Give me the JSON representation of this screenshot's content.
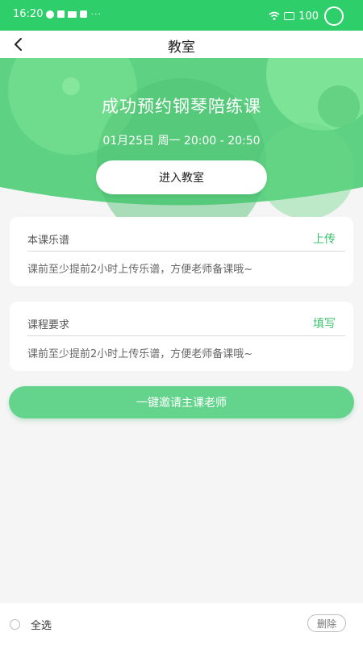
{
  "status_bar": {
    "time": "16:20",
    "dots": "···",
    "battery": "100",
    "icons": [
      "chat-icon",
      "sim-icon",
      "mail-icon",
      "bag-icon",
      "wifi-icon",
      "battery-icon",
      "circle-icon"
    ]
  },
  "nav": {
    "back_icon": "chevron-left-icon",
    "title": "教室"
  },
  "hero": {
    "title": "成功预约钢琴陪练课",
    "time": "01月25日 周一 20:00 - 20:50",
    "enter_label": "进入教室"
  },
  "sheet_music": {
    "label": "本课乐谱",
    "action": "上传",
    "hint": "课前至少提前2小时上传乐谱，方便老师备课哦~"
  },
  "requirements": {
    "label": "课程要求",
    "action": "填写",
    "hint": "课前至少提前2小时上传乐谱，方便老师备课哦~"
  },
  "invite": {
    "label": "一键邀请主课老师"
  },
  "bottom": {
    "select_all": "全选",
    "delete": "删除"
  },
  "colors": {
    "status_green": "#2ecf6b",
    "hero_green": "#5ed282",
    "accent_green": "#3cc26f",
    "invite_green": "#64d48d",
    "background": "#f5f5f5"
  }
}
